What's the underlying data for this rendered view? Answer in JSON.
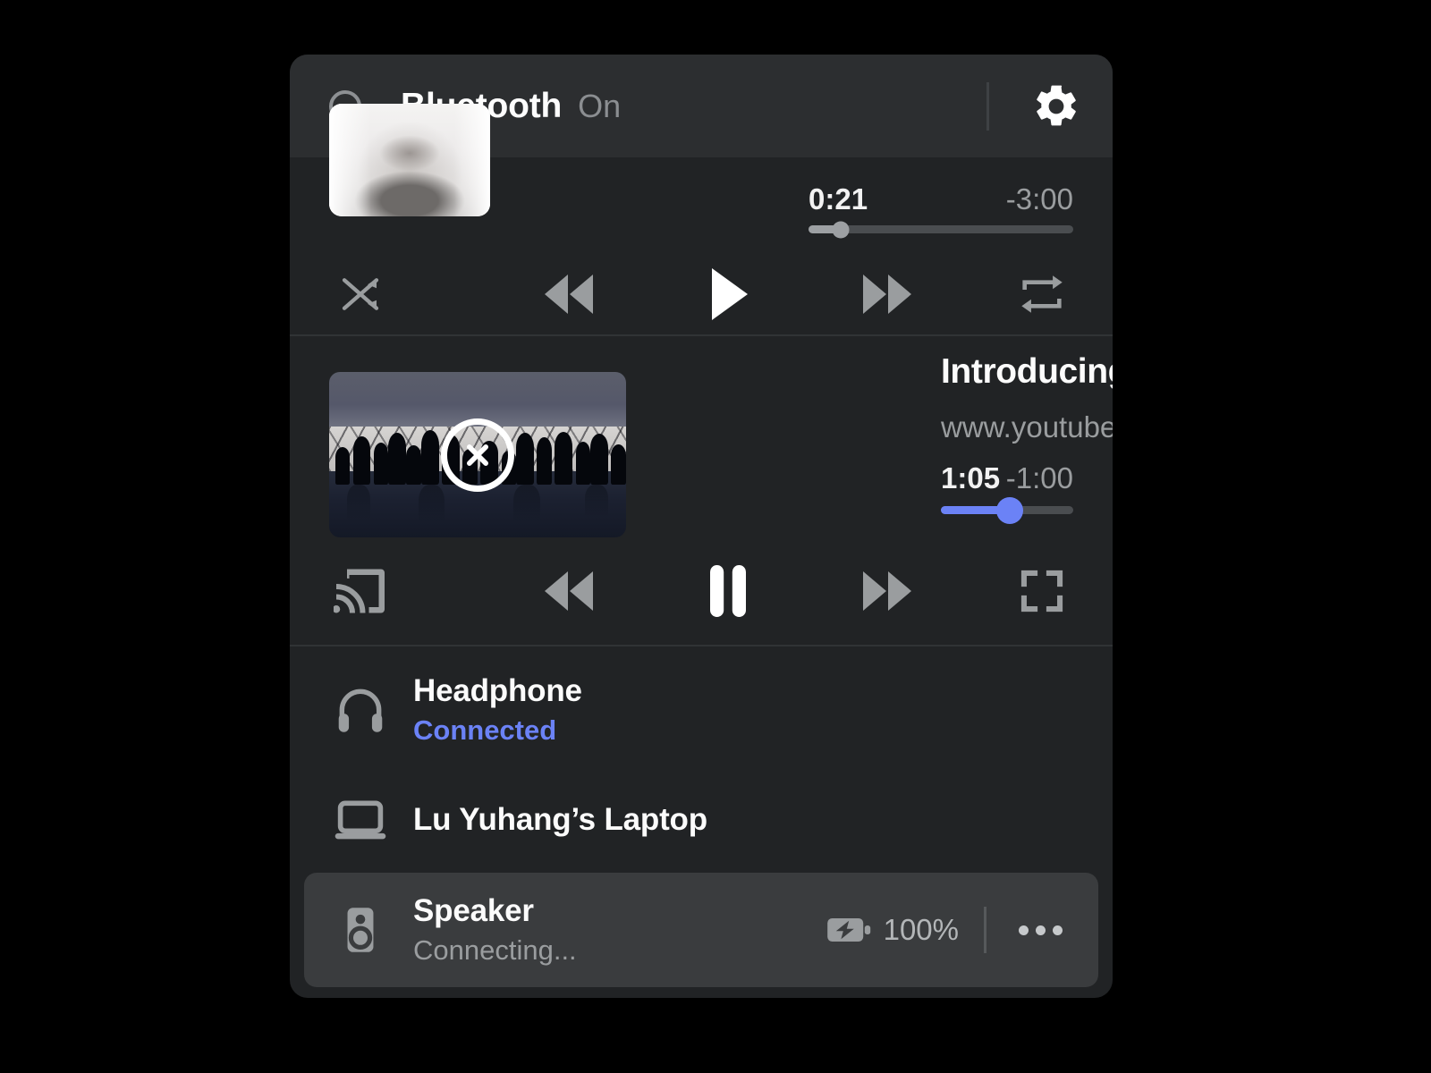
{
  "header": {
    "bluetooth_icon": "bluetooth-ring-icon",
    "title": "Bluetooth",
    "state": "On",
    "settings_icon": "gear-icon"
  },
  "music_player": {
    "album_art": "album-art-portrait",
    "current_time": "0:21",
    "remaining_time": "-3:00",
    "progress_percent": 12,
    "progress_color": "#9da0a3",
    "controls": {
      "shuffle": "shuffle-icon",
      "previous": "rewind-icon",
      "play": "play-icon",
      "next": "fast-forward-icon",
      "repeat": "repeat-icon"
    }
  },
  "video_player": {
    "thumbnail": "video-thumbnail-gallery-crowd",
    "close_label": "×",
    "title": "Introducing Apple Wa...",
    "source": "www.youtube.com",
    "current_time": "1:05",
    "remaining_time": "-1:00",
    "progress_percent": 52,
    "progress_color": "#6b82f6",
    "controls": {
      "cast": "cast-icon",
      "previous": "rewind-icon",
      "pause": "pause-icon",
      "next": "fast-forward-icon",
      "fullscreen": "fullscreen-icon"
    }
  },
  "devices": [
    {
      "icon": "headphone-icon",
      "name": "Headphone",
      "status": "Connected",
      "status_color": "#6b82f6",
      "highlighted": false,
      "battery": null,
      "has_more_menu": false
    },
    {
      "icon": "laptop-icon",
      "name": "Lu Yuhang’s Laptop",
      "status": null,
      "highlighted": false,
      "battery": null,
      "has_more_menu": false
    },
    {
      "icon": "speaker-icon",
      "name": "Speaker",
      "status": "Connecting...",
      "status_color": "#9a9d9f",
      "highlighted": true,
      "battery": "100%",
      "battery_icon": "battery-charging-icon",
      "has_more_menu": true,
      "more_menu_icon": "more-options-icon"
    }
  ],
  "colors": {
    "panel_bg": "#212325",
    "header_bg": "#2c2e30",
    "accent": "#6b82f6",
    "highlight_row": "#3a3c3e",
    "text_primary": "#fbfbfb",
    "text_secondary": "#9a9d9f",
    "control_icon": "#9a9d9f"
  }
}
